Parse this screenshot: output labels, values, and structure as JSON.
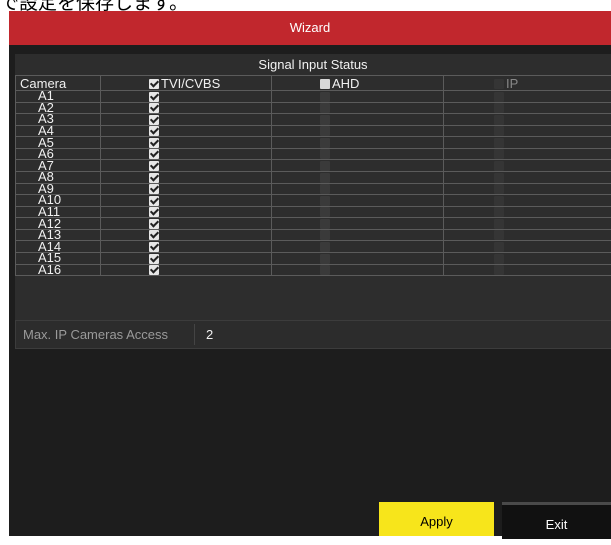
{
  "page_caption": "で設定を保存します。",
  "window": {
    "title": "Wizard"
  },
  "signal_input": {
    "title": "Signal Input Status",
    "columns": [
      {
        "label": "Camera"
      },
      {
        "label": "TVI/CVBS",
        "checked": true
      },
      {
        "label": "AHD",
        "checked": false
      },
      {
        "label": "IP",
        "checked": false
      }
    ],
    "cameras": [
      "A1",
      "A2",
      "A3",
      "A4",
      "A5",
      "A6",
      "A7",
      "A8",
      "A9",
      "A10",
      "A11",
      "A12",
      "A13",
      "A14",
      "A15",
      "A16"
    ]
  },
  "max_ip": {
    "label": "Max. IP Cameras Access",
    "value": "2"
  },
  "buttons": {
    "apply": "Apply",
    "exit": "Exit"
  }
}
